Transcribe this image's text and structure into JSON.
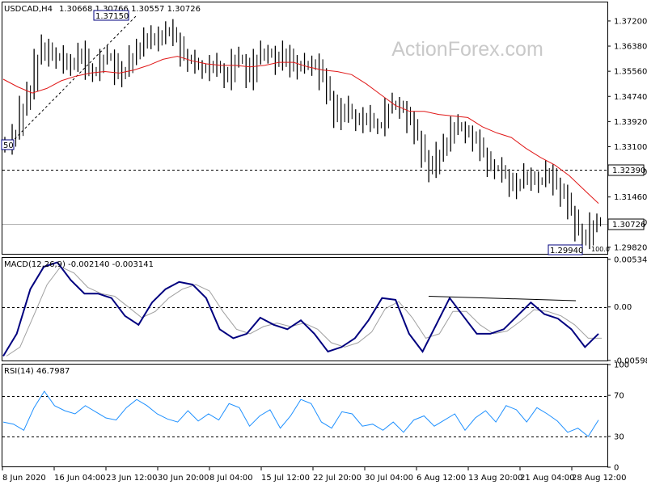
{
  "chart_data": [
    {
      "type": "line",
      "panel": "price",
      "title": "USDCAD,H4",
      "ohlc": "1.30668 1.30766 1.30557 1.30726",
      "watermark": "ActionForex.com",
      "y_ticks": [
        "1.37200",
        "1.36380",
        "1.35560",
        "1.34740",
        "1.33920",
        "1.33100",
        "1.32280",
        "1.31460",
        "1.30640",
        "1.29820"
      ],
      "ylim": [
        1.2958,
        1.3762
      ],
      "level_label": "1.32390",
      "last_price_label": "1.30726",
      "annotations": {
        "high": "1.37150",
        "low": "1.29940",
        "fib_start": "50",
        "fib_end": "100.0"
      },
      "series": [
        {
          "values": [
            1.332,
            1.3355,
            1.344,
            1.35,
            1.36,
            1.364,
            1.36,
            1.3605,
            1.357,
            1.359,
            1.362,
            1.355,
            1.356,
            1.36,
            1.3605,
            1.354,
            1.356,
            1.3605,
            1.364,
            1.367,
            1.365,
            1.368,
            1.369,
            1.366,
            1.36,
            1.359,
            1.357,
            1.356,
            1.358,
            1.356,
            1.353,
            1.36,
            1.359,
            1.353,
            1.36,
            1.362,
            1.361,
            1.358,
            1.362,
            1.3565,
            1.358,
            1.357,
            1.3585,
            1.353,
            1.347,
            1.34,
            1.344,
            1.341,
            1.339,
            1.341,
            1.338,
            1.338,
            1.344,
            1.345,
            1.343,
            1.339,
            1.334,
            1.327,
            1.323,
            1.329,
            1.333,
            1.338,
            1.337,
            1.335,
            1.333,
            1.3285,
            1.324,
            1.324,
            1.3215,
            1.3175,
            1.3195,
            1.322,
            1.3195,
            1.32,
            1.323,
            1.318,
            1.315,
            1.3095,
            1.303,
            1.2998,
            1.306,
            1.307
          ]
        },
        {
          "values": [
            1.353,
            1.3505,
            1.3485,
            1.35,
            1.3525,
            1.354,
            1.355,
            1.3555,
            1.355,
            1.356,
            1.3575,
            1.3595,
            1.3605,
            1.359,
            1.358,
            1.3575,
            1.3575,
            1.357,
            1.3575,
            1.3585,
            1.3585,
            1.357,
            1.356,
            1.3555,
            1.3545,
            1.3515,
            1.348,
            1.3445,
            1.3425,
            1.3425,
            1.3415,
            1.341,
            1.3405,
            1.3375,
            1.3355,
            1.334,
            1.3305,
            1.3275,
            1.325,
            1.3215,
            1.317,
            1.3125
          ]
        }
      ]
    },
    {
      "type": "line",
      "panel": "macd",
      "title": "MACD(12,26,9) -0.002140 -0.003141",
      "y_ticks": [
        "0.005341",
        "0.00",
        "-0.005989"
      ],
      "ylim": [
        -0.006,
        0.0055
      ],
      "series": [
        {
          "values": [
            -0.0055,
            -0.003,
            0.002,
            0.0045,
            0.005,
            0.003,
            0.0015,
            0.0015,
            0.001,
            -0.001,
            -0.002,
            0.0005,
            0.002,
            0.0028,
            0.0025,
            0.001,
            -0.0025,
            -0.0035,
            -0.003,
            -0.0012,
            -0.002,
            -0.0025,
            -0.0015,
            -0.003,
            -0.005,
            -0.0045,
            -0.0035,
            -0.0015,
            0.001,
            0.0008,
            -0.003,
            -0.005,
            -0.002,
            0.001,
            -0.001,
            -0.003,
            -0.003,
            -0.0025,
            -0.001,
            0.0005,
            -0.0008,
            -0.0013,
            -0.0025,
            -0.0045,
            -0.003
          ]
        },
        {
          "values": [
            -0.0055,
            -0.0045,
            -0.001,
            0.0025,
            0.0045,
            0.0038,
            0.0022,
            0.0015,
            0.0012,
            0.0,
            -0.0012,
            -0.0005,
            0.001,
            0.002,
            0.0025,
            0.0018,
            -0.0005,
            -0.0025,
            -0.003,
            -0.0022,
            -0.0018,
            -0.0022,
            -0.0018,
            -0.0025,
            -0.004,
            -0.0045,
            -0.004,
            -0.0028,
            -0.0002,
            0.0006,
            -0.0012,
            -0.0035,
            -0.003,
            -0.0005,
            -0.0005,
            -0.002,
            -0.003,
            -0.0027,
            -0.0016,
            -0.0003,
            -0.0005,
            -0.001,
            -0.002,
            -0.0035,
            -0.0035
          ]
        },
        {
          "values": [
            0.0012,
            0.0007
          ]
        }
      ]
    },
    {
      "type": "line",
      "panel": "rsi",
      "title": "RSI(14) 46.7987",
      "y_ticks": [
        "100",
        "70",
        "30",
        "0"
      ],
      "ylim": [
        0,
        100
      ],
      "series": [
        {
          "values": [
            44,
            42,
            36,
            58,
            74,
            60,
            55,
            52,
            60,
            54,
            48,
            46,
            58,
            66,
            60,
            52,
            47,
            44,
            55,
            45,
            52,
            46,
            62,
            58,
            40,
            50,
            56,
            38,
            50,
            66,
            62,
            44,
            38,
            54,
            52,
            40,
            42,
            36,
            44,
            34,
            46,
            50,
            40,
            46,
            52,
            36,
            48,
            55,
            44,
            60,
            56,
            44,
            58,
            52,
            45,
            34,
            38,
            30,
            46
          ]
        }
      ]
    }
  ],
  "x_axis": {
    "labels": [
      "8 Jun 2020",
      "16 Jun 04:00",
      "23 Jun 12:00",
      "30 Jun 20:00",
      "8 Jul 04:00",
      "15 Jul 12:00",
      "22 Jul 20:00",
      "30 Jul 04:00",
      "6 Aug 12:00",
      "13 Aug 20:00",
      "21 Aug 04:00",
      "28 Aug 12:00"
    ]
  },
  "colors": {
    "bars": "#000000",
    "moving_average": "#e01818",
    "macd_line": "#00007f",
    "signal_line": "#a0a0a0",
    "rsi_line": "#1e90ff",
    "level_line": "#000000"
  }
}
